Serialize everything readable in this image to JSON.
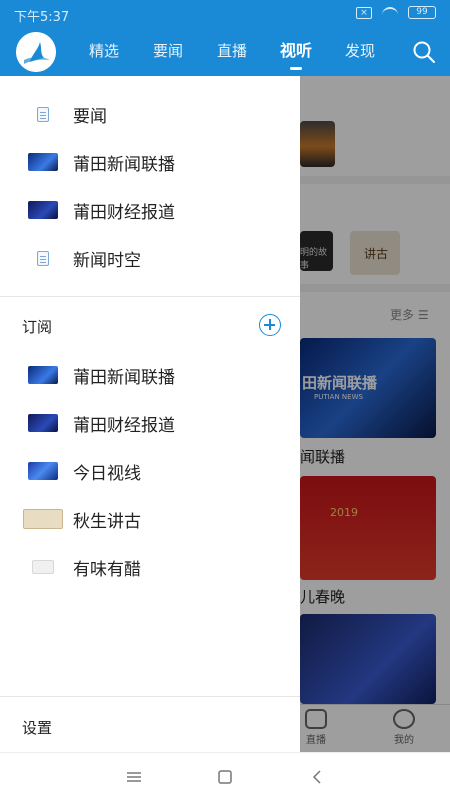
{
  "status": {
    "time": "下午5:37",
    "battery": "99",
    "sim": "×"
  },
  "header": {
    "tabs": [
      {
        "label": "精选"
      },
      {
        "label": "要闻"
      },
      {
        "label": "直播"
      },
      {
        "label": "视听",
        "active": true
      },
      {
        "label": "发现"
      }
    ],
    "icons": {
      "logo": "app-logo",
      "search": "search-icon"
    }
  },
  "drawer": {
    "top_items": [
      {
        "label": "要闻",
        "icon": "document-icon"
      },
      {
        "label": "莆田新闻联播",
        "icon": "thumbnail"
      },
      {
        "label": "莆田财经报道",
        "icon": "thumbnail"
      },
      {
        "label": "新闻时空",
        "icon": "document-icon"
      }
    ],
    "subscribe_title": "订阅",
    "subscribe_items": [
      {
        "label": "莆田新闻联播"
      },
      {
        "label": "莆田财经报道"
      },
      {
        "label": "今日视线"
      },
      {
        "label": "秋生讲古"
      },
      {
        "label": "有味有醋"
      }
    ],
    "settings_label": "设置"
  },
  "background": {
    "more_label": "更多",
    "captions": [
      "闻联播",
      "儿春晚"
    ],
    "thumb_text": [
      "田新闻联播",
      "PUTIAN NEWS",
      "2019",
      "明的故事",
      "讲古"
    ],
    "bottom_items": [
      {
        "label": "直播"
      },
      {
        "label": "我的"
      }
    ]
  },
  "colors": {
    "brand": "#1a8ad6",
    "accent": "#1a8ad6"
  }
}
